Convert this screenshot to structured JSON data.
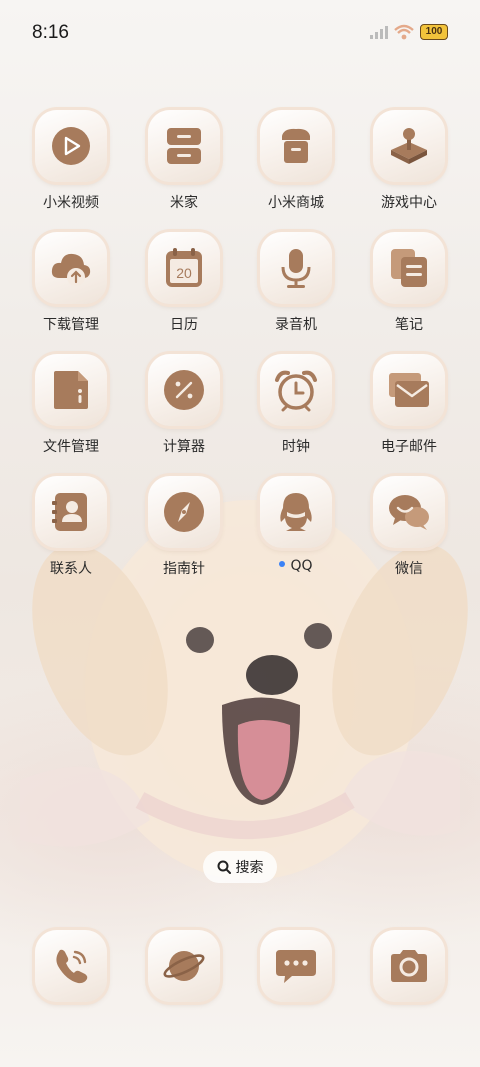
{
  "status_bar": {
    "time": "8:16",
    "battery": "100",
    "battery_color": "#f2c33b"
  },
  "apps": [
    {
      "name": "mi-video",
      "label": "小米视频",
      "icon": "play-circle-icon"
    },
    {
      "name": "mi-home",
      "label": "米家",
      "icon": "home-device-icon"
    },
    {
      "name": "mi-store",
      "label": "小米商城",
      "icon": "store-icon"
    },
    {
      "name": "game-center",
      "label": "游戏中心",
      "icon": "joystick-icon"
    },
    {
      "name": "downloads",
      "label": "下载管理",
      "icon": "cloud-upload-icon"
    },
    {
      "name": "calendar",
      "label": "日历",
      "icon": "calendar-icon",
      "icon_text": "20"
    },
    {
      "name": "recorder",
      "label": "录音机",
      "icon": "microphone-icon"
    },
    {
      "name": "notes",
      "label": "笔记",
      "icon": "notes-icon"
    },
    {
      "name": "file-manager",
      "label": "文件管理",
      "icon": "file-icon"
    },
    {
      "name": "calculator",
      "label": "计算器",
      "icon": "percent-icon"
    },
    {
      "name": "clock",
      "label": "时钟",
      "icon": "alarm-clock-icon"
    },
    {
      "name": "email",
      "label": "电子邮件",
      "icon": "envelope-icon"
    },
    {
      "name": "contacts",
      "label": "联系人",
      "icon": "contact-card-icon"
    },
    {
      "name": "compass",
      "label": "指南针",
      "icon": "compass-icon"
    },
    {
      "name": "qq",
      "label": "QQ",
      "icon": "qq-penguin-icon",
      "new_dot": true
    },
    {
      "name": "wechat",
      "label": "微信",
      "icon": "wechat-bubble-icon"
    }
  ],
  "search": {
    "label": "搜索",
    "icon": "search-icon"
  },
  "dock": [
    {
      "name": "phone",
      "icon": "phone-icon"
    },
    {
      "name": "browser",
      "icon": "planet-icon"
    },
    {
      "name": "messages",
      "icon": "chat-bubble-icon"
    },
    {
      "name": "camera",
      "icon": "camera-icon"
    }
  ],
  "colors": {
    "icon_glyph": "#9c7356",
    "new_dot": "#3b82f6"
  }
}
